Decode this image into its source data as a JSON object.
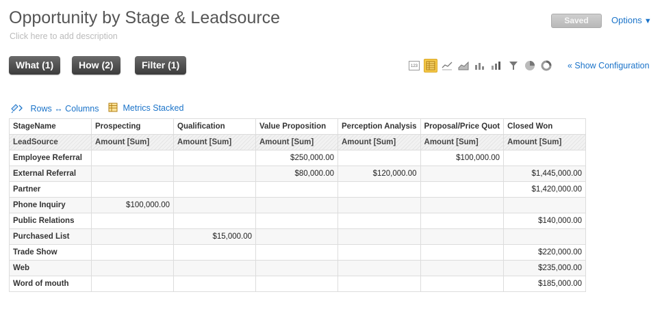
{
  "header": {
    "title": "Opportunity by Stage & Leadsource",
    "description_placeholder": "Click here to add description",
    "saved_label": "Saved",
    "options_label": "Options",
    "options_caret": "▼"
  },
  "toolbar": {
    "what_label": "What (1)",
    "how_label": "How (2)",
    "filter_label": "Filter (1)",
    "show_configuration_label": "« Show Configuration",
    "viz_icons": [
      "number-icon",
      "table-icon",
      "line-chart-icon",
      "area-chart-icon",
      "bar-chart-icon",
      "stacked-bar-icon",
      "funnel-icon",
      "pie-chart-icon",
      "donut-chart-icon"
    ],
    "active_viz": "table-icon"
  },
  "pivot_controls": {
    "rows_columns_label": "Rows ↔ Columns",
    "metrics_stacked_label": "Metrics Stacked"
  },
  "table": {
    "header1": [
      "StageName",
      "Prospecting",
      "Qualification",
      "Value Proposition",
      "Perception Analysis",
      "Proposal/Price Quot",
      "Closed Won"
    ],
    "header2": [
      "LeadSource",
      "Amount [Sum]",
      "Amount [Sum]",
      "Amount [Sum]",
      "Amount [Sum]",
      "Amount [Sum]",
      "Amount [Sum]"
    ],
    "rows": [
      [
        "Employee Referral",
        "",
        "",
        "$250,000.00",
        "",
        "$100,000.00",
        ""
      ],
      [
        "External Referral",
        "",
        "",
        "$80,000.00",
        "$120,000.00",
        "",
        "$1,445,000.00"
      ],
      [
        "Partner",
        "",
        "",
        "",
        "",
        "",
        "$1,420,000.00"
      ],
      [
        "Phone Inquiry",
        "$100,000.00",
        "",
        "",
        "",
        "",
        ""
      ],
      [
        "Public Relations",
        "",
        "",
        "",
        "",
        "",
        "$140,000.00"
      ],
      [
        "Purchased List",
        "",
        "$15,000.00",
        "",
        "",
        "",
        ""
      ],
      [
        "Trade Show",
        "",
        "",
        "",
        "",
        "",
        "$220,000.00"
      ],
      [
        "Web",
        "",
        "",
        "",
        "",
        "",
        "$235,000.00"
      ],
      [
        "Word of mouth",
        "",
        "",
        "",
        "",
        "",
        "$185,000.00"
      ]
    ]
  },
  "colors": {
    "link": "#1a73c9",
    "active_icon": "#f5c94a",
    "dark_button": "#4a4a4a"
  }
}
